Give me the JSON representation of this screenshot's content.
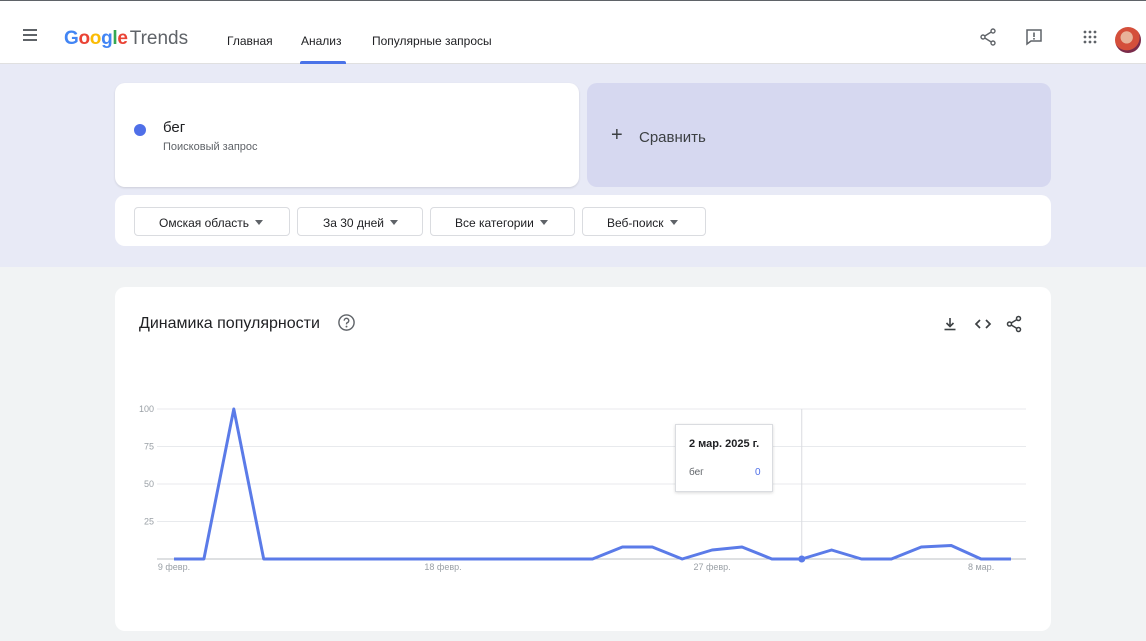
{
  "header": {
    "logo_g1": "G",
    "logo_g2": "o",
    "logo_g3": "o",
    "logo_g4": "g",
    "logo_g5": "l",
    "logo_g6": "e",
    "logo_product": "Trends",
    "nav": [
      {
        "label": "Главная"
      },
      {
        "label": "Анализ",
        "active": true
      },
      {
        "label": "Популярные запросы"
      }
    ]
  },
  "search": {
    "term": "бег",
    "term_type": "Поисковый запрос",
    "term_color": "#4f6fe8",
    "compare_plus": "+",
    "compare_label": "Сравнить"
  },
  "filters": {
    "region": "Омская область",
    "period": "За 30 дней",
    "category": "Все категории",
    "search_type": "Веб-поиск"
  },
  "chart_card": {
    "title": "Динамика популярности"
  },
  "chart_data": {
    "type": "line",
    "title": "Динамика популярности",
    "x_tick_labels": [
      "9 февр.",
      "18 февр.",
      "27 февр.",
      "8 мар."
    ],
    "x_tick_days": [
      0,
      9,
      18,
      27
    ],
    "y_tick_labels": [
      "100",
      "75",
      "50",
      "25"
    ],
    "ylim": [
      0,
      100
    ],
    "grid": true,
    "series": [
      {
        "name": "бег",
        "color": "#5b7be8",
        "values": [
          0,
          0,
          100,
          0,
          0,
          0,
          0,
          0,
          0,
          0,
          0,
          0,
          0,
          0,
          0,
          8,
          8,
          0,
          6,
          8,
          0,
          0,
          6,
          0,
          0,
          8,
          9,
          0,
          0
        ]
      }
    ],
    "hover_index": 21
  },
  "tooltip": {
    "date": "2 мар. 2025 г.",
    "term": "бег",
    "value": "0"
  }
}
